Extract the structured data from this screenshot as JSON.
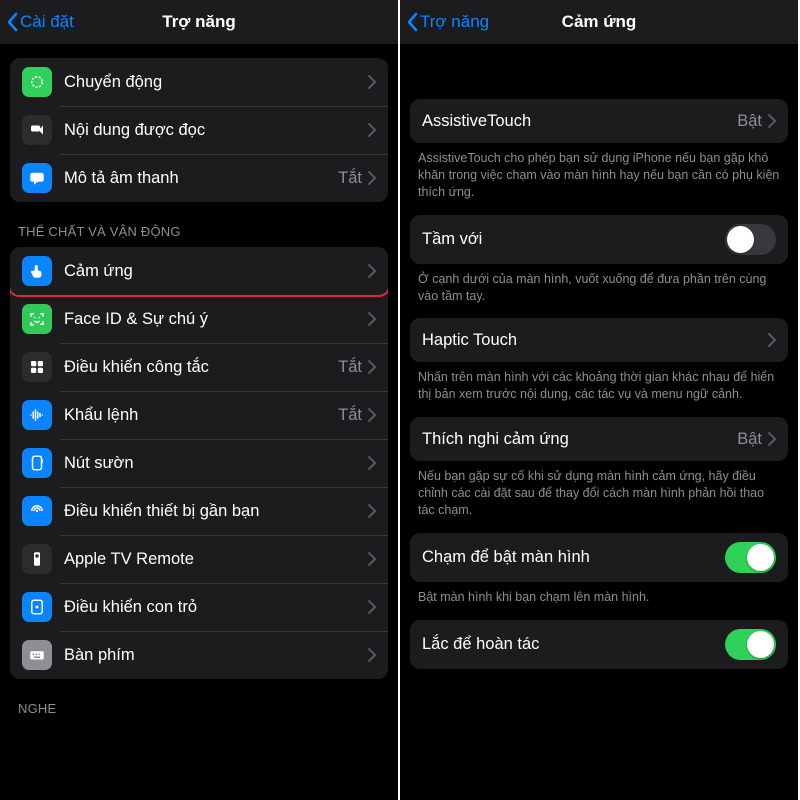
{
  "left": {
    "back_label": "Cài đặt",
    "title": "Trợ năng",
    "group1": [
      {
        "icon": "motion",
        "bg": "bg-green1",
        "label": "Chuyển động",
        "value": ""
      },
      {
        "icon": "speech",
        "bg": "bg-dark",
        "label": "Nội dung được đọc",
        "value": ""
      },
      {
        "icon": "bubble",
        "bg": "bg-blue",
        "label": "Mô tả âm thanh",
        "value": "Tắt"
      }
    ],
    "section_header": "THỂ CHẤT VÀ VẬN ĐỘNG",
    "group2": [
      {
        "icon": "touch",
        "bg": "bg-blue",
        "label": "Cảm ứng",
        "value": "",
        "hl": true
      },
      {
        "icon": "faceid",
        "bg": "bg-green2",
        "label": "Face ID & Sự chú ý",
        "value": ""
      },
      {
        "icon": "switch",
        "bg": "bg-dark",
        "label": "Điều khiển công tắc",
        "value": "Tắt"
      },
      {
        "icon": "voice",
        "bg": "bg-blue",
        "label": "Khẩu lệnh",
        "value": "Tắt"
      },
      {
        "icon": "side",
        "bg": "bg-blue",
        "label": "Nút sườn",
        "value": ""
      },
      {
        "icon": "remote",
        "bg": "bg-blue",
        "label": "Điều khiển thiết bị gần bạn",
        "value": ""
      },
      {
        "icon": "appletv",
        "bg": "bg-dark",
        "label": "Apple TV Remote",
        "value": ""
      },
      {
        "icon": "pointer",
        "bg": "bg-blue",
        "label": "Điều khiển con trỏ",
        "value": ""
      },
      {
        "icon": "keyboard",
        "bg": "bg-grey",
        "label": "Bàn phím",
        "value": ""
      }
    ],
    "section_header2": "NGHE"
  },
  "right": {
    "back_label": "Trợ năng",
    "title": "Cảm ứng",
    "assistive": {
      "label": "AssistiveTouch",
      "value": "Bật",
      "hl": true
    },
    "assistive_desc": "AssistiveTouch cho phép bạn sử dụng iPhone nếu bạn gặp khó khăn trong việc chạm vào màn hình hay nếu bạn cần có phụ kiện thích ứng.",
    "reach": {
      "label": "Tầm với",
      "on": false
    },
    "reach_desc": "Ở cạnh dưới của màn hình, vuốt xuống để đưa phần trên cùng vào tầm tay.",
    "haptic": {
      "label": "Haptic Touch",
      "value": ""
    },
    "haptic_desc": "Nhấn trên màn hình với các khoảng thời gian khác nhau để hiển thị bản xem trước nội dung, các tác vụ và menu ngữ cảnh.",
    "accom": {
      "label": "Thích nghi cảm ứng",
      "value": "Bật"
    },
    "accom_desc": "Nếu bạn gặp sự cố khi sử dụng màn hình cảm ứng, hãy điều chỉnh các cài đặt sau để thay đổi cách màn hình phản hồi thao tác chạm.",
    "tapwake": {
      "label": "Chạm để bật màn hình",
      "on": true
    },
    "tapwake_desc": "Bật màn hình khi bạn chạm lên màn hình.",
    "shake": {
      "label": "Lắc để hoàn tác",
      "on": true
    }
  }
}
